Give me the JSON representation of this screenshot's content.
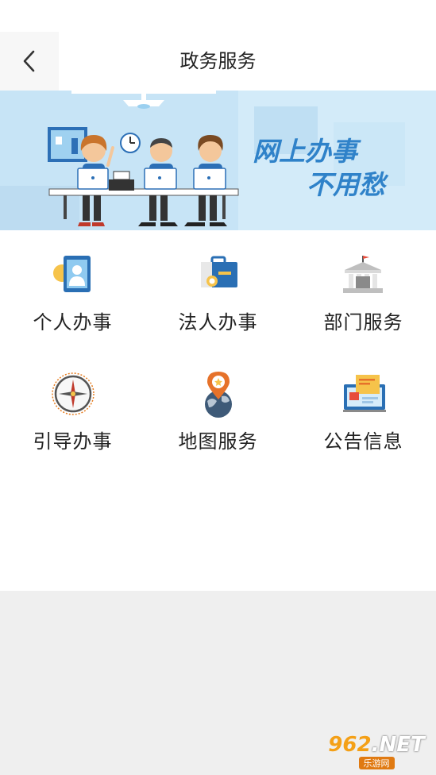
{
  "header": {
    "title": "政务服务"
  },
  "banner": {
    "line1": "网上办事",
    "line2": "不用愁"
  },
  "services": [
    {
      "label": "个人办事",
      "icon": "person-id-card-icon"
    },
    {
      "label": "法人办事",
      "icon": "briefcase-icon"
    },
    {
      "label": "部门服务",
      "icon": "government-building-icon"
    },
    {
      "label": "引导办事",
      "icon": "compass-icon"
    },
    {
      "label": "地图服务",
      "icon": "map-pin-globe-icon"
    },
    {
      "label": "公告信息",
      "icon": "bulletin-board-icon"
    }
  ],
  "watermark": {
    "number": "962",
    "suffix": ".NET",
    "caption": "乐游网"
  },
  "colors": {
    "banner_bg": "#c9e6f7",
    "banner_text": "#2f82c9",
    "accent_blue": "#2a6fb4",
    "accent_orange": "#f0a21c",
    "footer_bg": "#efefef"
  }
}
